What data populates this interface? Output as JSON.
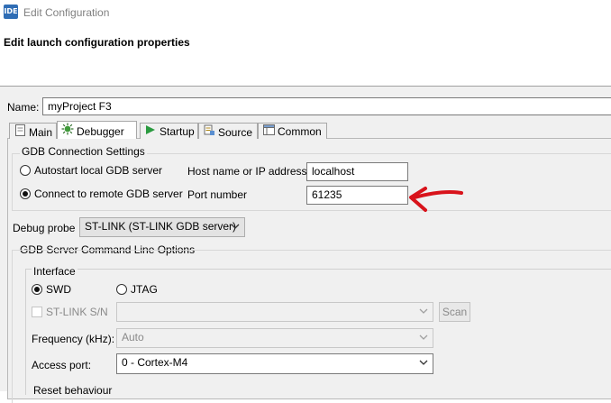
{
  "window": {
    "title": "Edit Configuration",
    "app_icon_text": "IDE"
  },
  "header": {
    "title": "Edit launch configuration properties"
  },
  "name_field": {
    "label": "Name:",
    "value": "myProject F3"
  },
  "tabs": [
    {
      "label": "Main",
      "icon": "page-icon"
    },
    {
      "label": "Debugger",
      "icon": "bug-icon"
    },
    {
      "label": "Startup",
      "icon": "play-icon"
    },
    {
      "label": "Source",
      "icon": "source-icon"
    },
    {
      "label": "Common",
      "icon": "common-icon"
    }
  ],
  "gdb_connection": {
    "group_title": "GDB Connection Settings",
    "autostart_label": "Autostart local GDB server",
    "connect_remote_label": "Connect to remote GDB server",
    "selected": "connect_remote",
    "host_label": "Host name or IP address",
    "host_value": "localhost",
    "port_label": "Port number",
    "port_value": "61235"
  },
  "debug_probe": {
    "label": "Debug probe",
    "value": "ST-LINK (ST-LINK GDB server)"
  },
  "gdb_server_options": {
    "group_title": "GDB Server Command Line Options",
    "interface_title": "Interface",
    "swd_label": "SWD",
    "jtag_label": "JTAG",
    "selected": "SWD",
    "stlink_sn_label": "ST-LINK S/N",
    "stlink_sn_value": "",
    "scan_label": "Scan",
    "frequency_label": "Frequency (kHz):",
    "frequency_value": "Auto",
    "access_port_label": "Access port:",
    "access_port_value": "0 - Cortex-M4",
    "reset_behaviour_label": "Reset behaviour"
  },
  "annotation": {
    "arrow_color": "#d8131b"
  },
  "colors": {
    "selected_radio": "#111111",
    "border": "#7a7a7a"
  }
}
